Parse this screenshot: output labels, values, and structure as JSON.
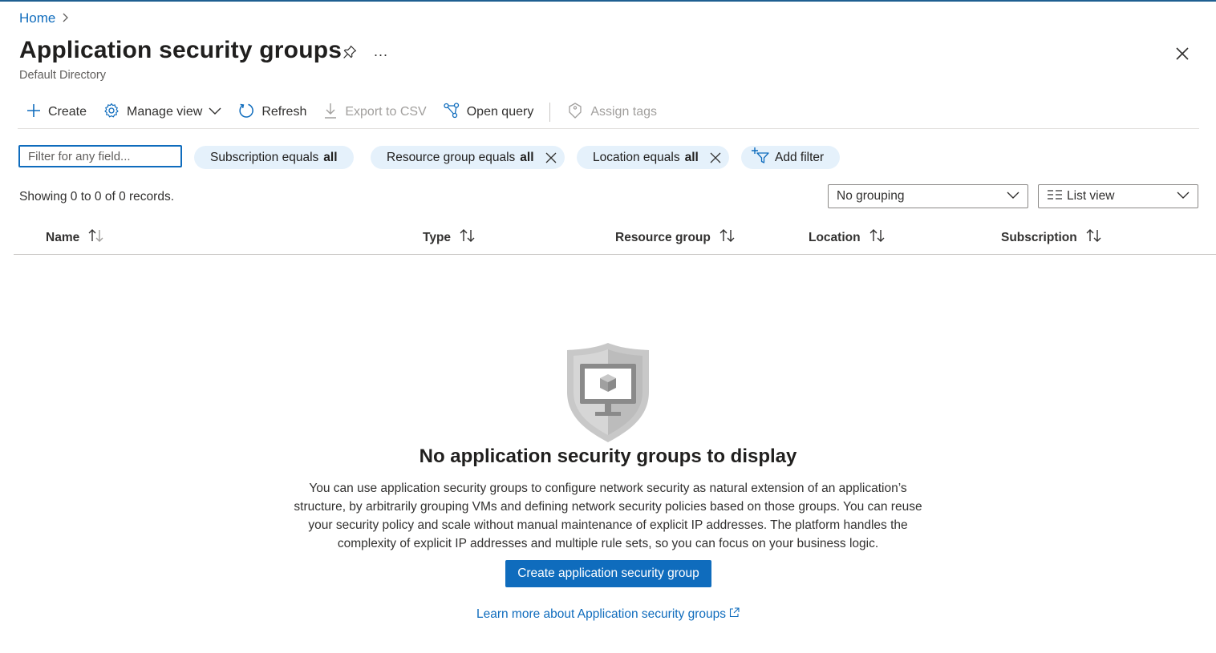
{
  "breadcrumb": {
    "home": "Home"
  },
  "header": {
    "title": "Application security groups",
    "subtitle": "Default Directory",
    "more_label": "..."
  },
  "toolbar": {
    "create": "Create",
    "manage_view": "Manage view",
    "refresh": "Refresh",
    "export_csv": "Export to CSV",
    "open_query": "Open query",
    "assign_tags": "Assign tags"
  },
  "filters": {
    "search_placeholder": "Filter for any field...",
    "subscription": {
      "prefix": "Subscription equals",
      "value": "all"
    },
    "resource_group": {
      "prefix": "Resource group equals",
      "value": "all"
    },
    "location": {
      "prefix": "Location equals",
      "value": "all"
    },
    "add_filter": "Add filter"
  },
  "records_text": "Showing 0 to 0 of 0 records.",
  "grouping": {
    "selected": "No grouping"
  },
  "view": {
    "selected": "List view"
  },
  "table": {
    "columns": [
      "Name",
      "Type",
      "Resource group",
      "Location",
      "Subscription"
    ]
  },
  "empty_state": {
    "title": "No application security groups to display",
    "description_lines": [
      "You can use application security groups to configure network security as natural extension of an application’s",
      "structure, by arbitrarily grouping VMs and defining network security policies based on those groups. You can reuse",
      "your security policy and scale without manual maintenance of explicit IP addresses. The platform handles the",
      "complexity of explicit IP addresses and multiple rule sets, so you can focus on your business logic."
    ],
    "cta": "Create application security group",
    "learn_more": "Learn more about Application security groups"
  },
  "colors": {
    "accent": "#0f6cbd",
    "pill_bg": "#e5f1fb",
    "text": "#323130"
  }
}
